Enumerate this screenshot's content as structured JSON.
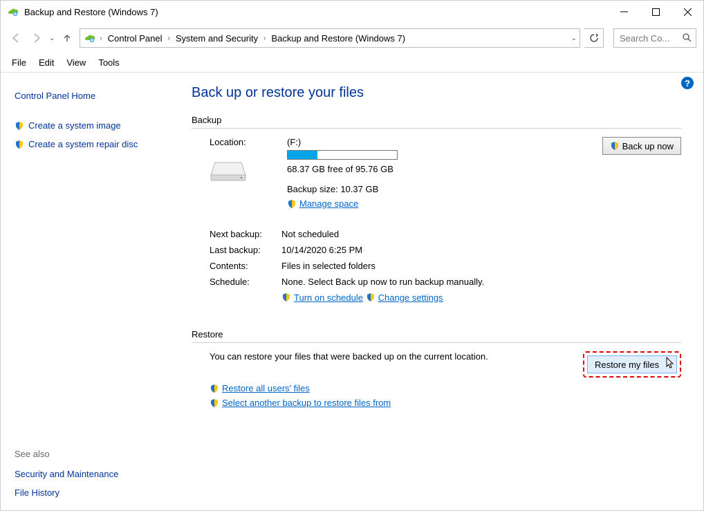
{
  "window": {
    "title": "Backup and Restore (Windows 7)"
  },
  "breadcrumbs": {
    "items": [
      "Control Panel",
      "System and Security",
      "Backup and Restore (Windows 7)"
    ]
  },
  "search": {
    "placeholder": "Search Co..."
  },
  "menu": {
    "file": "File",
    "edit": "Edit",
    "view": "View",
    "tools": "Tools"
  },
  "sidebar": {
    "home": "Control Panel Home",
    "create_image": "Create a system image",
    "create_repair": "Create a system repair disc",
    "see_also": "See also",
    "security": "Security and Maintenance",
    "file_history": "File History"
  },
  "main": {
    "title": "Back up or restore your files",
    "backup_heading": "Backup",
    "location_label": "Location:",
    "location_value": "(F:)",
    "free_space": "68.37 GB free of 95.76 GB",
    "backup_size": "Backup size: 10.37 GB",
    "manage_space": "Manage space",
    "backup_now": "Back up now",
    "progress_pct": 27,
    "next_backup_label": "Next backup:",
    "next_backup_value": "Not scheduled",
    "last_backup_label": "Last backup:",
    "last_backup_value": "10/14/2020 6:25 PM",
    "contents_label": "Contents:",
    "contents_value": "Files in selected folders",
    "schedule_label": "Schedule:",
    "schedule_value": "None. Select Back up now to run backup manually.",
    "turn_on_schedule": "Turn on schedule",
    "change_settings": "Change settings",
    "restore_heading": "Restore",
    "restore_text": "You can restore your files that were backed up on the current location.",
    "restore_my_files": "Restore my files",
    "restore_all_users": "Restore all users' files",
    "select_another": "Select another backup to restore files from"
  }
}
